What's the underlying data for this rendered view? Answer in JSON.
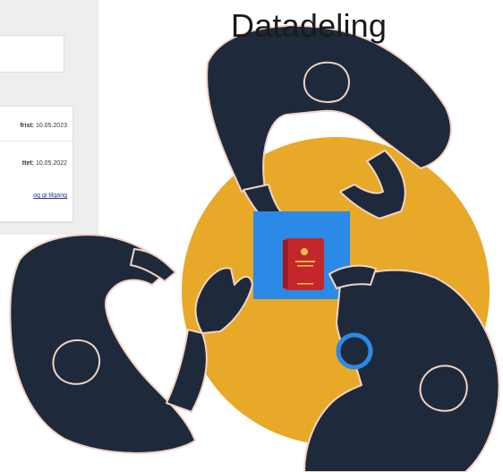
{
  "title": "Datadeling",
  "ui_card": {
    "deadline_label": "frist:",
    "deadline_value": "10.05.2023",
    "created_label": "ttet:",
    "created_value": "10.05.2022",
    "link_text": "og gi tilgang"
  },
  "colors": {
    "circle": "#E8A928",
    "people": "#1E2A3B",
    "outline": "#F2D3C4",
    "table": "#2B8AE6",
    "book": "#C4272B",
    "cup_ring": "#2B8AE6"
  },
  "icons": {
    "book": "red-law-book-icon",
    "cup": "coffee-cup-icon"
  }
}
